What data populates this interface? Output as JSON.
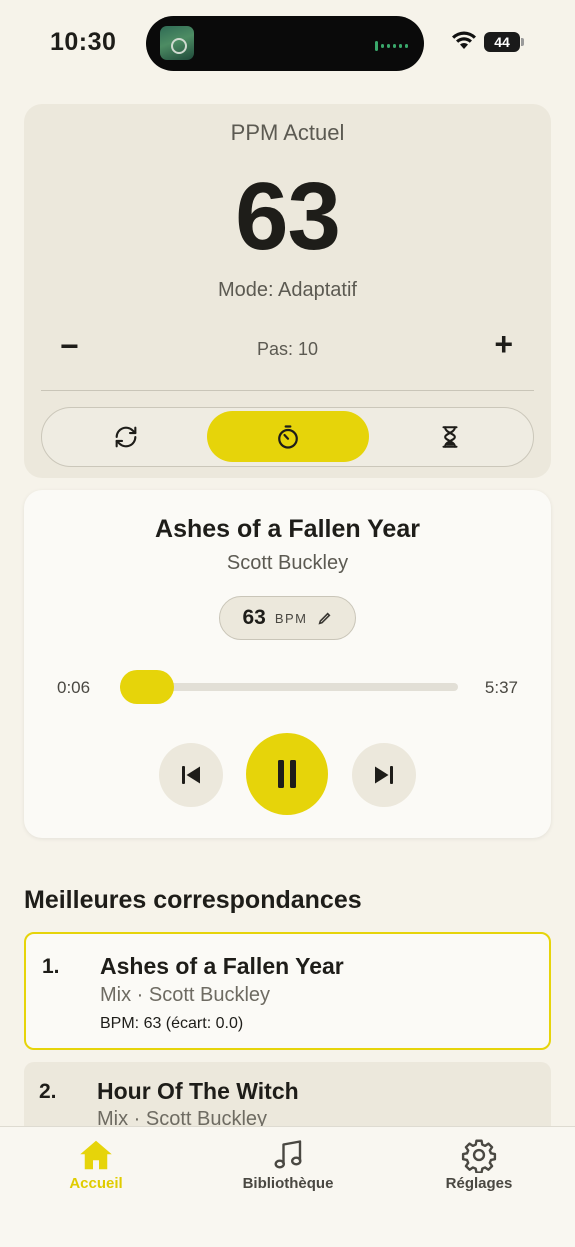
{
  "status_bar": {
    "time": "10:30",
    "battery": "44",
    "battery_level": 0.44
  },
  "bpm_card": {
    "title": "PPM Actuel",
    "value": "63",
    "mode": "Mode: Adaptatif",
    "step_minus": "−",
    "step_label": "Pas: 10",
    "step_plus": "+",
    "modes": [
      {
        "icon": "sync-icon",
        "active": false
      },
      {
        "icon": "timer-icon",
        "active": true
      },
      {
        "icon": "hourglass-icon",
        "active": false
      }
    ]
  },
  "player": {
    "title": "Ashes of a Fallen Year",
    "artist": "Scott Buckley",
    "bpm_value": "63",
    "bpm_unit": "BPM",
    "bpm_edit_icon": "pencil-icon",
    "current_time": "0:06",
    "total_time": "5:37",
    "progress": 0.06,
    "controls": [
      "skip-previous-icon",
      "pause-icon",
      "skip-next-icon"
    ]
  },
  "matches": {
    "title": "Meilleures correspondances",
    "items": [
      {
        "rank": "1.",
        "title": "Ashes of a Fallen Year",
        "subtitle": "Mix · Scott Buckley",
        "bpm": "BPM: 63 (écart: 0.0)",
        "selected": true
      },
      {
        "rank": "2.",
        "title": "Hour Of The Witch",
        "subtitle": "Mix · Scott Buckley",
        "selected": false
      }
    ]
  },
  "tabs": [
    {
      "label": "Accueil",
      "icon": "home-icon",
      "active": true
    },
    {
      "label": "Bibliothèque",
      "icon": "music-note-icon",
      "active": false
    },
    {
      "label": "Réglages",
      "icon": "gear-icon",
      "active": false
    }
  ],
  "colors": {
    "accent": "#e6d40a",
    "background": "#f6f3ea",
    "card": "#ece8dc",
    "surface": "#fbfaf6"
  }
}
